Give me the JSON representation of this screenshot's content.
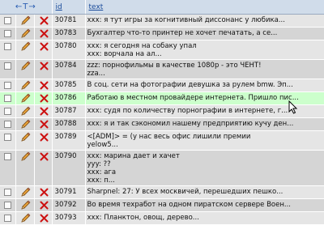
{
  "header": {
    "arrows": "←T→",
    "id_label": "id",
    "text_label": "text"
  },
  "rows": [
    {
      "id": "30781",
      "text": "xxx: я тут игры за когнитивный диссонанс у любика...",
      "lines": 1
    },
    {
      "id": "30783",
      "text": "Бухгалтер что-то принтер не хочет печатать, а се...",
      "lines": 1
    },
    {
      "id": "30780",
      "text": "xxx: я сегодня на собаку упал\nxxx: ворчала на ал...",
      "lines": 2
    },
    {
      "id": "30784",
      "text": "zzz: порнофильмы в качестве 1080p - это ЧЕНТ!\nzza...",
      "lines": 2
    },
    {
      "id": "30785",
      "text": "В соц. сети на фотографии девушка за рулем bmw. Эп...",
      "lines": 1
    },
    {
      "id": "30786",
      "text": "Работаю в местном провайдере интернета. Пришло пис...",
      "lines": 1
    },
    {
      "id": "30787",
      "text": "xxx: судя по количеству порнографии в интернете, г...",
      "lines": 1
    },
    {
      "id": "30788",
      "text": "xxx: я и так сэкономил нашему предприятию кучу ден...",
      "lines": 1
    },
    {
      "id": "30789",
      "text": "<[ADM]> = (у нас весь офис лишили премии\nyelow5...",
      "lines": 2
    },
    {
      "id": "30790",
      "text": "xxx: марина дает и хачет\nyyy: ??\nxxx: ага\nxxx: п...",
      "lines": 4
    },
    {
      "id": "30791",
      "text": "Sharpnel: 27: У всех москвичей, перешедших пешко...",
      "lines": 1
    },
    {
      "id": "30792",
      "text": "Во время техработ на одном пиратском сервере Воен...",
      "lines": 1
    },
    {
      "id": "30793",
      "text": "xxx: Планктон, овощ, дерево...",
      "lines": 1
    }
  ],
  "highlight_index": 5,
  "colors": {
    "row_odd": "#e5e5e5",
    "row_even": "#d5d5d5",
    "row_highlight": "#ccffcc",
    "header_bg": "#d0dcea",
    "delete_red": "#cc1111"
  }
}
